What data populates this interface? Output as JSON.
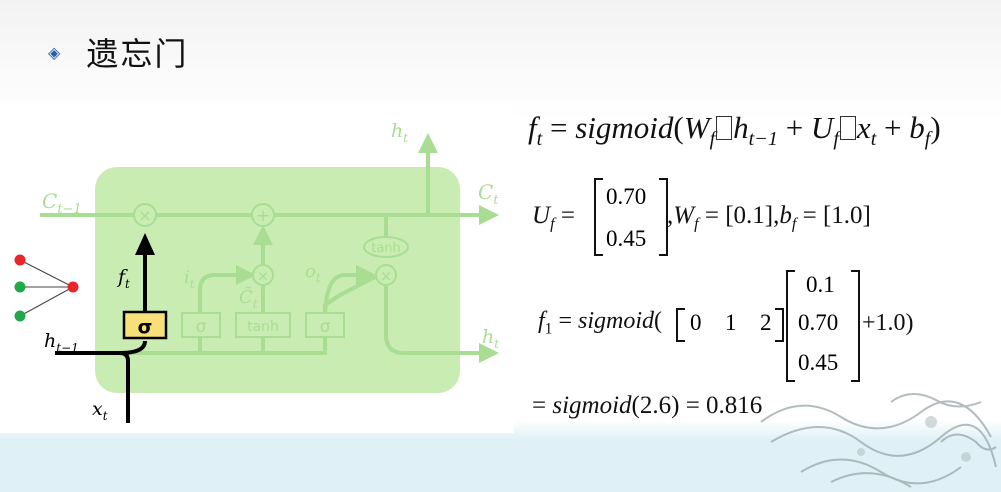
{
  "slide": {
    "bullet_glyph": "◈",
    "title": "遗忘门"
  },
  "diagram": {
    "labels": {
      "c_prev": "C",
      "c_prev_sub": "t−1",
      "c_next": "C",
      "c_next_sub": "t",
      "h_top": "h",
      "h_top_sub": "t",
      "h_right": "h",
      "h_right_sub": "t",
      "h_prev": "h",
      "h_prev_sub": "t−1",
      "x": "x",
      "x_sub": "t",
      "f": "f",
      "f_sub": "t",
      "i": "i",
      "i_sub": "t",
      "o": "o",
      "o_sub": "t",
      "c_tilde": "C̃",
      "c_tilde_sub": "t"
    },
    "ops": {
      "times": "×",
      "plus": "+",
      "tanh": "tanh",
      "sigma": "σ"
    },
    "colors": {
      "cell_bg": "#c9ecb2",
      "faded_line": "#a9dd93",
      "sigma_highlight": "#f7e07a",
      "neuron_red": "#e8262b",
      "neuron_green": "#22a84a"
    }
  },
  "equations": {
    "eq1": {
      "f": "f",
      "f_sub": "t",
      "eq": " = ",
      "fn": "sigmoid",
      "open": "(",
      "W": "W",
      "W_sub": "f",
      "h": "h",
      "h_sub": "t−1",
      "plus1": " + ",
      "U": "U",
      "U_sub": "f",
      "x": "x",
      "x_sub": "t",
      "plus2": " + ",
      "b": "b",
      "b_sub": "f",
      "close": ")"
    },
    "eq2": {
      "U": "U",
      "U_sub": "f",
      "eq": " =",
      "u_values": [
        "0.70",
        "0.45"
      ],
      "tail_comma": ",",
      "W": "W",
      "W_sub": "f",
      "W_val": " = [0.1],",
      "b": "b",
      "b_sub": "f",
      "b_val": " = [1.0]"
    },
    "eq3": {
      "f": "f",
      "f_sub": "1",
      "eq": " = ",
      "fn": "sigmoid",
      "open": "(",
      "row": [
        "0",
        "1",
        "2"
      ],
      "col": [
        "0.1",
        "0.70",
        "0.45"
      ],
      "tail": "+1.0)"
    },
    "eq4": {
      "eq": "= ",
      "fn": "sigmoid",
      "arg": "(2.6)",
      "result": " = 0.816"
    }
  }
}
